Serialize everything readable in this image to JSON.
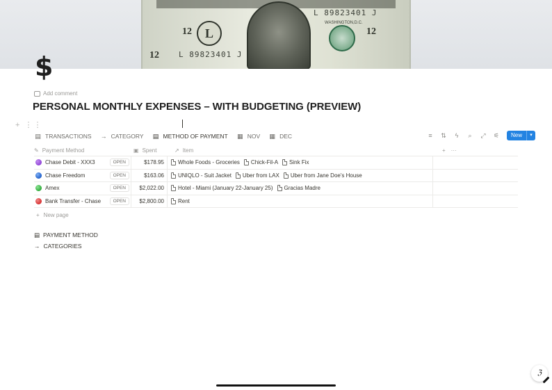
{
  "page": {
    "icon": "$",
    "add_comment": "Add comment",
    "title": "PERSONAL MONTHLY EXPENSES – WITH BUDGETING (PREVIEW)"
  },
  "cover": {
    "serial_top": "L 89823401 J",
    "serial_bottom": "L 89823401 J",
    "denomination": "12",
    "seal_letter": "L",
    "city": "WASHINGTON,D.C."
  },
  "views": [
    {
      "label": "TRANSACTIONS",
      "icon": "card-icon"
    },
    {
      "label": "CATEGORY",
      "icon": "arrow-right-icon"
    },
    {
      "label": "METHOD OF PAYMENT",
      "icon": "card-icon"
    },
    {
      "label": "NOV",
      "icon": "calendar-icon"
    },
    {
      "label": "DEC",
      "icon": "calendar-icon"
    }
  ],
  "toolbar": {
    "new_label": "New"
  },
  "table": {
    "headers": {
      "payment_method": "Payment Method",
      "spent": "Spent",
      "item": "Item"
    },
    "open_label": "OPEN",
    "rows": [
      {
        "method": "Chase Debit - XXX3",
        "color": "#8e44d6",
        "spent": "$178.95",
        "items": [
          "Whole Foods - Groceries",
          "Chick-Fil-A",
          "Sink Fix"
        ]
      },
      {
        "method": "Chase Freedom",
        "color": "#1f5fc9",
        "spent": "$163.06",
        "items": [
          "UNIQLO - Suit Jacket",
          "Uber from LAX",
          "Uber from Jane Doe's House"
        ]
      },
      {
        "method": "Amex",
        "color": "#2faa3a",
        "spent": "$2,022.00",
        "items": [
          "Hotel - Miami (January 22-January 25)",
          "Gracias Madre"
        ]
      },
      {
        "method": "Bank Transfer - Chase",
        "color": "#d62f2f",
        "spent": "$2,800.00",
        "items": [
          "Rent"
        ]
      }
    ],
    "new_page": "New page"
  },
  "links": [
    {
      "label": "PAYMENT METHOD",
      "icon": "card-icon"
    },
    {
      "label": "CATEGORIES",
      "icon": "arrow-right-icon"
    }
  ]
}
